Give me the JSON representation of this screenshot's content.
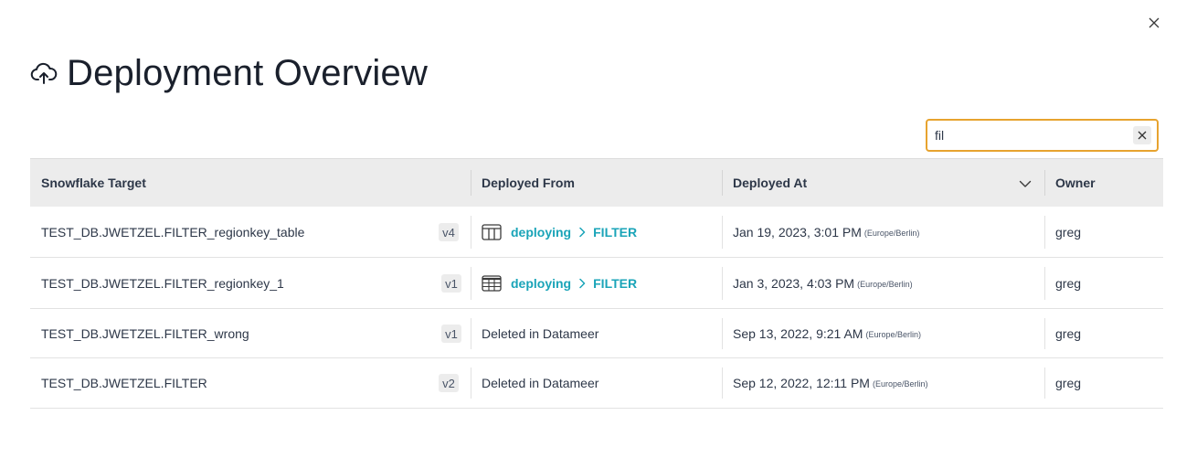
{
  "dialog": {
    "title": "Deployment Overview"
  },
  "search": {
    "value": "fil",
    "placeholder": ""
  },
  "table": {
    "columns": [
      "Snowflake Target",
      "Deployed From",
      "Deployed At",
      "Owner"
    ],
    "rows": [
      {
        "target": "TEST_DB.JWETZEL.FILTER_regionkey_table",
        "version": "v4",
        "from_type": "link",
        "from_workbook": "deploying",
        "from_node": "FILTER",
        "from_icon": "table-columns-icon",
        "deployed_at": "Jan 19, 2023, 3:01 PM",
        "timezone": "(Europe/Berlin)",
        "owner": "greg"
      },
      {
        "target": "TEST_DB.JWETZEL.FILTER_regionkey_1",
        "version": "v1",
        "from_type": "link",
        "from_workbook": "deploying",
        "from_node": "FILTER",
        "from_icon": "table-grid-icon",
        "deployed_at": "Jan 3, 2023, 4:03 PM",
        "timezone": "(Europe/Berlin)",
        "owner": "greg"
      },
      {
        "target": "TEST_DB.JWETZEL.FILTER_wrong",
        "version": "v1",
        "from_type": "text",
        "from_text": "Deleted in Datameer",
        "deployed_at": "Sep 13, 2022, 9:21 AM",
        "timezone": "(Europe/Berlin)",
        "owner": "greg"
      },
      {
        "target": "TEST_DB.JWETZEL.FILTER",
        "version": "v2",
        "from_type": "text",
        "from_text": "Deleted in Datameer",
        "deployed_at": "Sep 12, 2022, 12:11 PM",
        "timezone": "(Europe/Berlin)",
        "owner": "greg"
      }
    ]
  },
  "colors": {
    "accent_link": "#1aa4b8",
    "focus_border": "#e7a32f",
    "header_bg": "#ececec"
  }
}
